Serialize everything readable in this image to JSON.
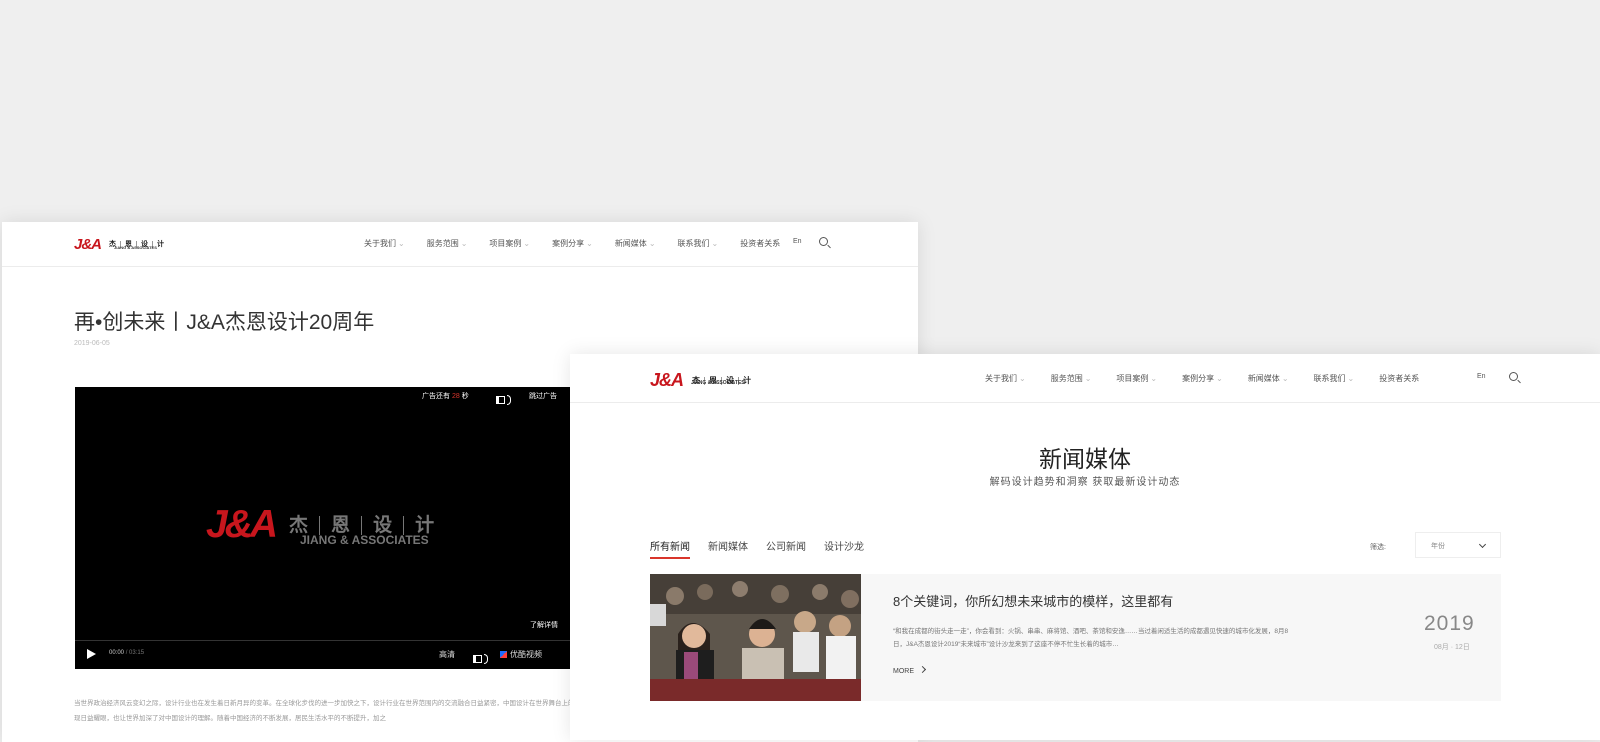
{
  "colors": {
    "brand_red": "#c8161d",
    "accent": "#d9352b",
    "background": "#efefef"
  },
  "logo": {
    "mark": "J&A",
    "chinese": [
      "杰",
      "恩",
      "设",
      "计"
    ],
    "english": "JIANG & ASSOCIATES"
  },
  "nav": {
    "items": [
      {
        "label": "关于我们",
        "dropdown": true
      },
      {
        "label": "服务范围",
        "dropdown": true
      },
      {
        "label": "项目案例",
        "dropdown": true
      },
      {
        "label": "案例分享",
        "dropdown": true
      },
      {
        "label": "新闻媒体",
        "dropdown": true
      },
      {
        "label": "联系我们",
        "dropdown": true
      },
      {
        "label": "投资者关系",
        "dropdown": false
      }
    ],
    "chevron": "⌄",
    "lang": "En",
    "search_icon": "search-icon"
  },
  "article": {
    "title": "再•创未来丨J&A杰恩设计20周年",
    "date": "2019-06-05",
    "video": {
      "ad_prefix": "广告还有",
      "ad_seconds": "28",
      "ad_suffix": "秒",
      "skip": "跳过广告",
      "detail": "了解详情",
      "time_current": "00:00",
      "time_total": "/ 03:15",
      "quality": "高清",
      "provider": "优酷视频"
    },
    "body": "当世界政治经济风云变幻之际，设计行业也在发生着日新月异的变革。在全球化步伐的进一步加快之下，设计行业在世界范围内的交流融合日益紧密，中国设计在世界舞台上的表现日益耀眼，也让世界加深了对中国设计的理解。随着中国经济的不断发展，居民生活水平的不断提升，加之"
  },
  "news_page": {
    "title": "新闻媒体",
    "subtitle": "解码设计趋势和洞察  获取最新设计动态",
    "tabs": [
      "所有新闻",
      "新闻媒体",
      "公司新闻",
      "设计沙龙"
    ],
    "filter_label": "筛选:",
    "filter_value": "年份",
    "items": [
      {
        "title": "8个关键词，你所幻想未来城市的模样，这里都有",
        "excerpt": "“和我在成都的街头走一走”，你会看到：火锅、串串、麻将馆、酒吧、茶馆和安逸……当过着闲适生活的成都遇见快速的城市化发展，8月8日，J&A杰恩设计2019“未来城市”设计沙龙来到了这座不停不忙生长着的城市…",
        "more": "MORE",
        "year": "2019",
        "month_day": "08月 · 12日"
      }
    ]
  }
}
